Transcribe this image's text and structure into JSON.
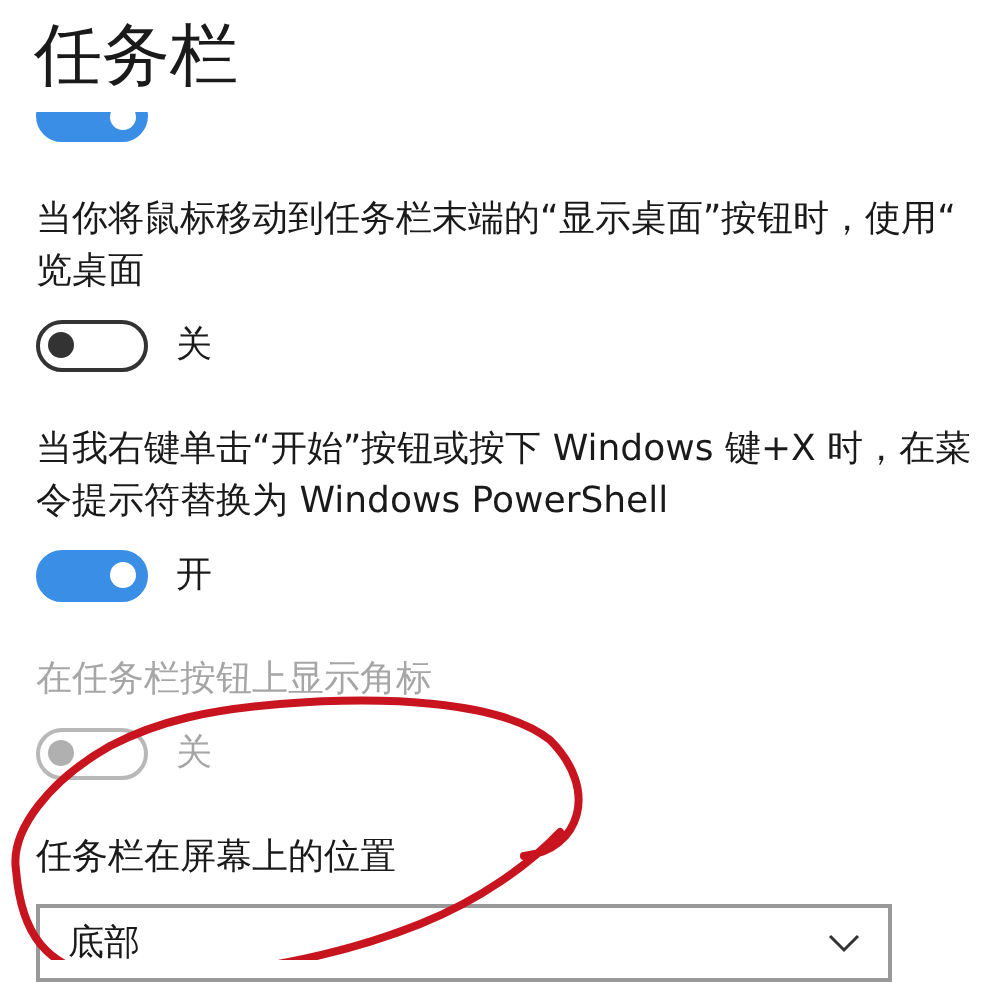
{
  "page_title": "任务栏",
  "partial_toggle": {
    "on": true
  },
  "settings": [
    {
      "kind": "toggle",
      "lines": [
        "当你将鼠标移动到任务栏末端的“显示桌面”按钮时，使用“",
        "览桌面"
      ],
      "on": false,
      "disabled": false,
      "state_text": "关"
    },
    {
      "kind": "toggle",
      "lines": [
        "当我右键单击“开始”按钮或按下 Windows 键+X 时，在菜",
        "令提示符替换为 Windows PowerShell"
      ],
      "on": true,
      "disabled": false,
      "state_text": "开"
    },
    {
      "kind": "toggle",
      "lines": [
        "在任务栏按钮上显示角标"
      ],
      "on": false,
      "disabled": true,
      "state_text": "关"
    },
    {
      "kind": "dropdown",
      "label": "任务栏在屏幕上的位置",
      "value": "底部"
    }
  ]
}
